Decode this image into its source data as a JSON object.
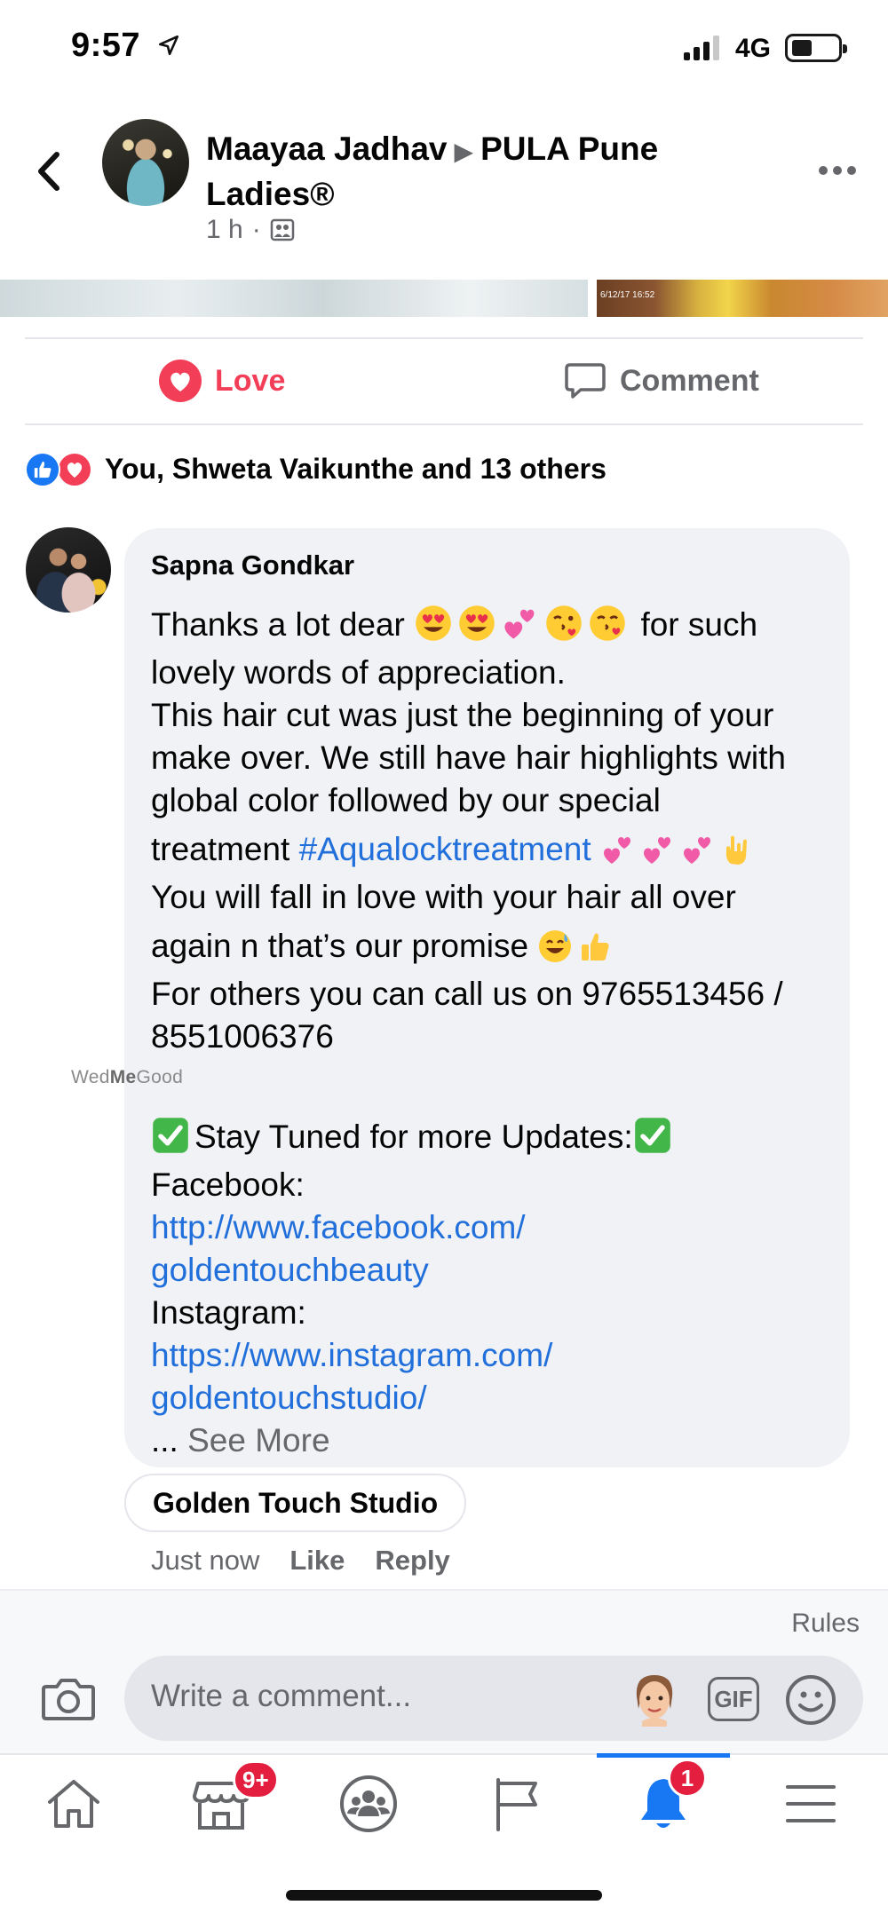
{
  "status_bar": {
    "time": "9:57",
    "network": "4G"
  },
  "post": {
    "author": "Maayaa Jadhav",
    "group": "PULA Pune Ladies®",
    "time": "1 h",
    "image_stamp": "6/12/17 16:52"
  },
  "actions": {
    "love_label": "Love",
    "comment_label": "Comment"
  },
  "reactions": {
    "summary": "You, Shweta Vaikunthe and 13 others"
  },
  "comment": {
    "author": "Sapna Gondkar",
    "line1_a": "Thanks a lot dear",
    "line1_b": " for such",
    "line2": "lovely words of appreciation.",
    "line3": "This hair cut was just the beginning of your",
    "line4": "make over. We still have hair highlights with",
    "line5": "global color followed by our special",
    "line6_a": "treatment ",
    "hashtag": "#Aqualocktreatment",
    "line7": "You will fall in love with your hair all over",
    "line8": "again n that’s our promise",
    "line9": "For others you can call us on 9765513456 /",
    "line10": "8551006376",
    "stay_tuned": "Stay Tuned for more Updates:",
    "facebook_label": "Facebook:",
    "facebook_link_1": "http://www.facebook.com/",
    "facebook_link_2": "goldentouchbeauty",
    "instagram_label": "Instagram:",
    "instagram_link_1": "https://www.instagram.com/",
    "instagram_link_2": "goldentouchstudio/",
    "see_more_prefix": "... ",
    "see_more": "See More"
  },
  "watermark": {
    "part1": "Wed",
    "part2": "Me",
    "part3": "Good"
  },
  "reply": {
    "author": "Golden Touch Studio",
    "time": "Just now",
    "like": "Like",
    "reply": "Reply"
  },
  "composer": {
    "rules": "Rules",
    "placeholder": "Write a comment...",
    "gif_label": "GIF"
  },
  "tab_bar": {
    "marketplace_badge": "9+",
    "notifications_badge": "1",
    "active_color": "#1877f2"
  },
  "colors": {
    "love": "#f33e58",
    "link": "#216fdb",
    "like_blue": "#1877f2",
    "bubble": "#f0f2f5",
    "badge": "#e41e3f"
  }
}
